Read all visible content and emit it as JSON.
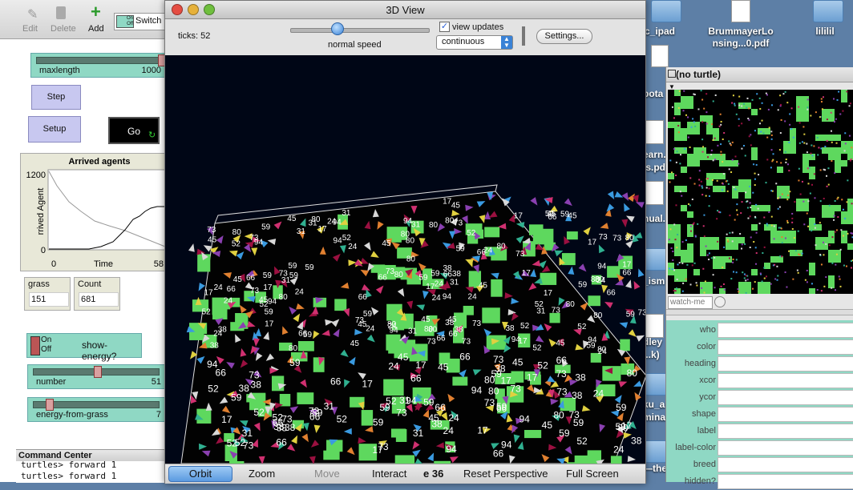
{
  "toolbar": {
    "edit": "Edit",
    "delete": "Delete",
    "add": "Add",
    "switch": "Switch",
    "onoff_on": "On",
    "onoff_off": "Off"
  },
  "sliders": [
    {
      "label": "maxlength",
      "value": "1000"
    },
    {
      "label": "number",
      "value": "51"
    },
    {
      "label": "energy-from-grass",
      "value": "7"
    }
  ],
  "buttons": {
    "step": "Step",
    "setup": "Setup",
    "go": "Go"
  },
  "plot": {
    "title": "Arrived agents",
    "ylabel": "rrived Agent",
    "xlabel": "Time",
    "ymax": "1200",
    "ymin": "0",
    "xmin": "0",
    "xmax": "58"
  },
  "monitors": [
    {
      "label": "grass",
      "value": "151"
    },
    {
      "label": "Count",
      "value": "681"
    }
  ],
  "switch": {
    "on": "On",
    "off": "Off",
    "label": "show-energy?"
  },
  "command_center": {
    "title": "Command Center",
    "lines": [
      "turtles> forward 1",
      "turtles> forward 1"
    ]
  },
  "window": {
    "title": "3D View",
    "ticks_label": "ticks: 52",
    "speed_label": "normal speed",
    "view_updates": "view updates",
    "update_mode": "continuous",
    "settings": "Settings..."
  },
  "bottom": {
    "orbit": "Orbit",
    "zoom": "Zoom",
    "move": "Move",
    "interact": "Interact",
    "fps": "36",
    "reset": "Reset Perspective",
    "full": "Full Screen"
  },
  "inspector": {
    "title": "(no turtle)",
    "watch": "watch-me",
    "fields": [
      "who",
      "color",
      "heading",
      "xcor",
      "ycor",
      "shape",
      "label",
      "label-color",
      "breed",
      "hidden?"
    ]
  },
  "desktop": [
    {
      "name": "c_ipad"
    },
    {
      "name": "BrummayerLo\nnsing...0.pdf"
    },
    {
      "name": "lililil"
    }
  ],
  "desktop_partial": [
    "pota",
    "earn.",
    "ls.pd",
    "nual.",
    "_ism",
    "dley",
    "...k)",
    "ku_a",
    "mina",
    "—the"
  ],
  "colors": {
    "grass": "#5ed85e",
    "view_bg": "#000616",
    "slider": "#8fd8c4",
    "button": "#c8c8f0"
  }
}
